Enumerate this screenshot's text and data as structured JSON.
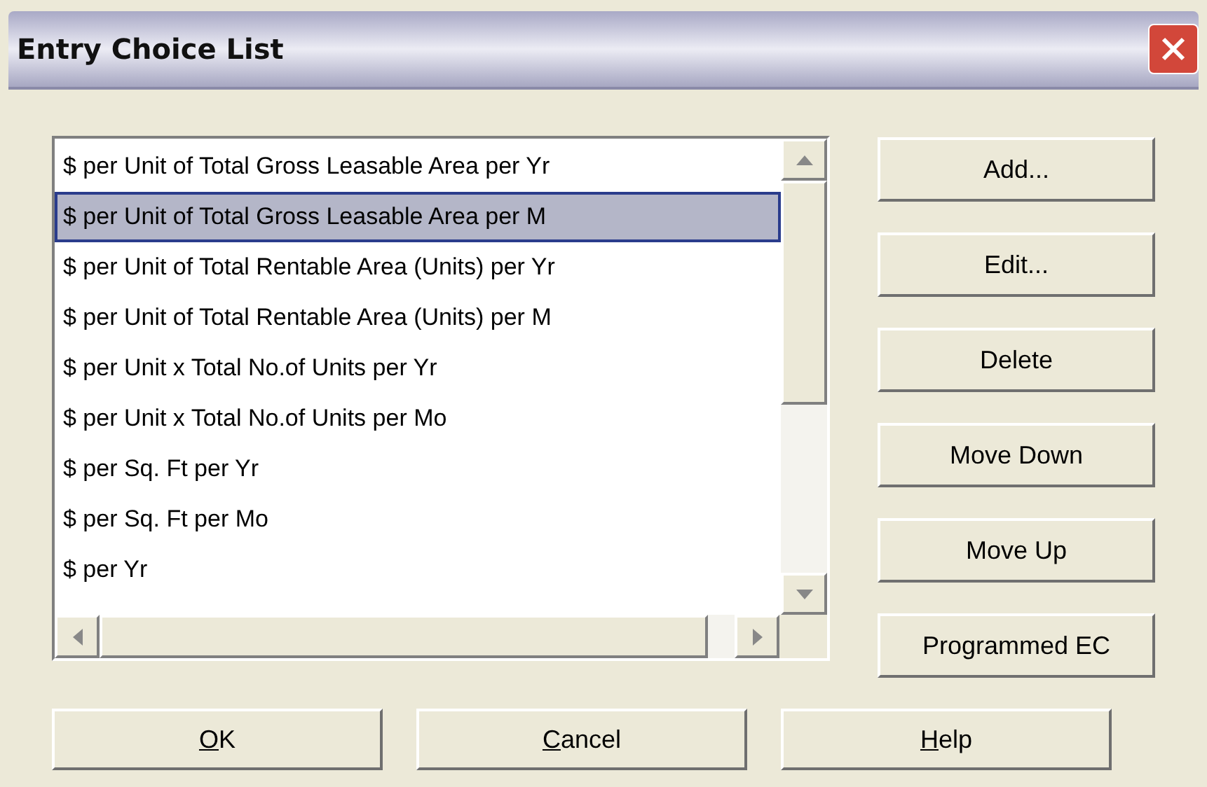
{
  "window": {
    "title": "Entry Choice List"
  },
  "list": {
    "items": [
      {
        "label": "$ per Unit of Total Gross Leasable Area per Yr",
        "selected": false
      },
      {
        "label": "$ per Unit of Total Gross Leasable Area per M",
        "selected": true
      },
      {
        "label": "$ per Unit of Total Rentable Area (Units) per Yr",
        "selected": false
      },
      {
        "label": "$ per Unit of Total Rentable Area (Units) per M",
        "selected": false
      },
      {
        "label": "$ per Unit x Total No.of Units per Yr",
        "selected": false
      },
      {
        "label": "$ per Unit x Total No.of Units per Mo",
        "selected": false
      },
      {
        "label": "$ per Sq. Ft per Yr",
        "selected": false
      },
      {
        "label": "$ per Sq. Ft per Mo",
        "selected": false
      },
      {
        "label": "$ per Yr",
        "selected": false
      }
    ]
  },
  "side_buttons": [
    "Add...",
    "Edit...",
    "Delete",
    "Move Down",
    "Move Up",
    "Programmed EC"
  ],
  "bottom_buttons": [
    {
      "label": "OK",
      "underline_first": true
    },
    {
      "label": "Cancel",
      "underline_first": true
    },
    {
      "label": "Help",
      "underline_first": true
    }
  ]
}
